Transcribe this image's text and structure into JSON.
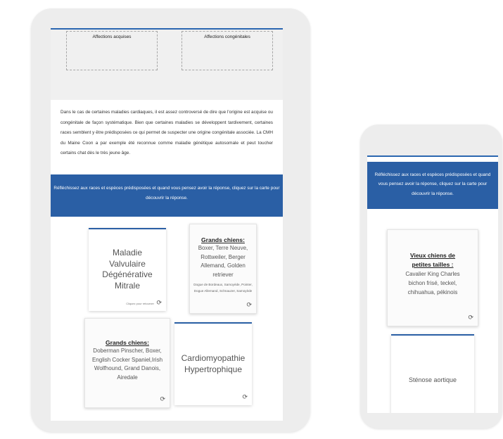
{
  "tablet": {
    "boxes": {
      "acquired_label": "Affections acquises",
      "congenital_label": "Affections congénitales"
    },
    "paragraph": "Dans le cas de certaines maladies cardiaques, il est assez controversé de dire que l'origine est acquise ou congénitale de façon systématique. Bien que certaines maladies se développent tardivement, certaines races semblent y être prédisposées ce qui permet de suspecter une origine congénitale associée. La CMH du Maine Coon a par exemple été reconnue comme maladie génétique autosomale et peut toucher certains chat dès le très jeune âge.",
    "banner": "Réfléchissez aux races et espèces prédisposées et quand vous pensez avoir la réponse, cliquez sur la carte pour découvrir la réponse.",
    "cards": {
      "mvd_front": "Maladie Valvulaire Dégénérative Mitrale",
      "mvd_hint": "Cliquez pour retourner",
      "large_dogs_1_title": "Grands chiens:",
      "large_dogs_1_text": "Boxer, Terre Neuve, Rottweiler, Berger Allemand, Golden retriever",
      "large_dogs_1_small": "Dogue de Bordeaux, Samoyède, Pointer, Dogue Allemand, Schnauzer, Samoyède",
      "large_dogs_2_title": "Grands chiens:",
      "large_dogs_2_text": "Doberman Pinscher, Boxer, English Cocker Spaniel,Irish Wolfhound, Grand Danois, Airedale",
      "hcm_front": "Cardiomyopathie Hypertrophique"
    }
  },
  "phone": {
    "banner": "Réfléchissez aux races et espèces prédisposées et quand vous pensez avoir la réponse, cliquez sur la carte pour découvrir la réponse.",
    "small_dogs_title": "Vieux chiens de petites tailles :",
    "small_dogs_text": "Cavalier King Charles bichon frisé, teckel, chihuahua, pékinois",
    "stenosis_front": "Sténose aortique"
  },
  "icons": {
    "flip": "flip-icon"
  },
  "colors": {
    "accent_blue": "#2a5fa5",
    "frame_gray": "#ededed"
  }
}
